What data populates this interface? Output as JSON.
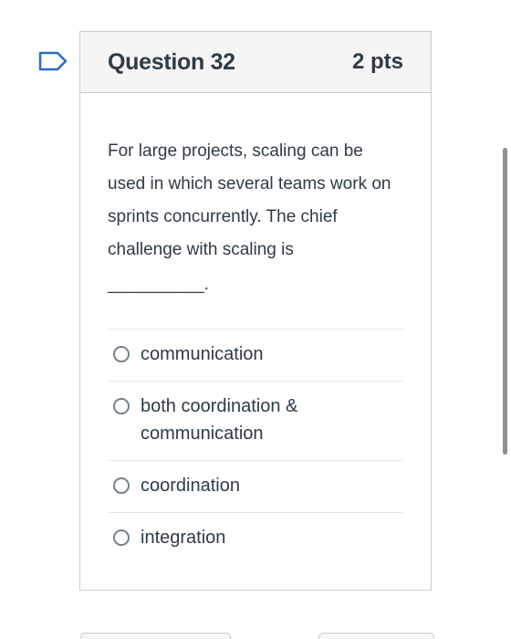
{
  "question": {
    "title": "Question 32",
    "points": "2 pts",
    "text": "For large projects, scaling can be used in which several teams work on sprints concurrently. The chief challenge with scaling is",
    "blank": "__________."
  },
  "answers": [
    {
      "label": "communication"
    },
    {
      "label": "both coordination & communication"
    },
    {
      "label": "coordination"
    },
    {
      "label": "integration"
    }
  ],
  "icons": {
    "flag": "flag-icon",
    "flag_color": "#2b6bc0"
  }
}
